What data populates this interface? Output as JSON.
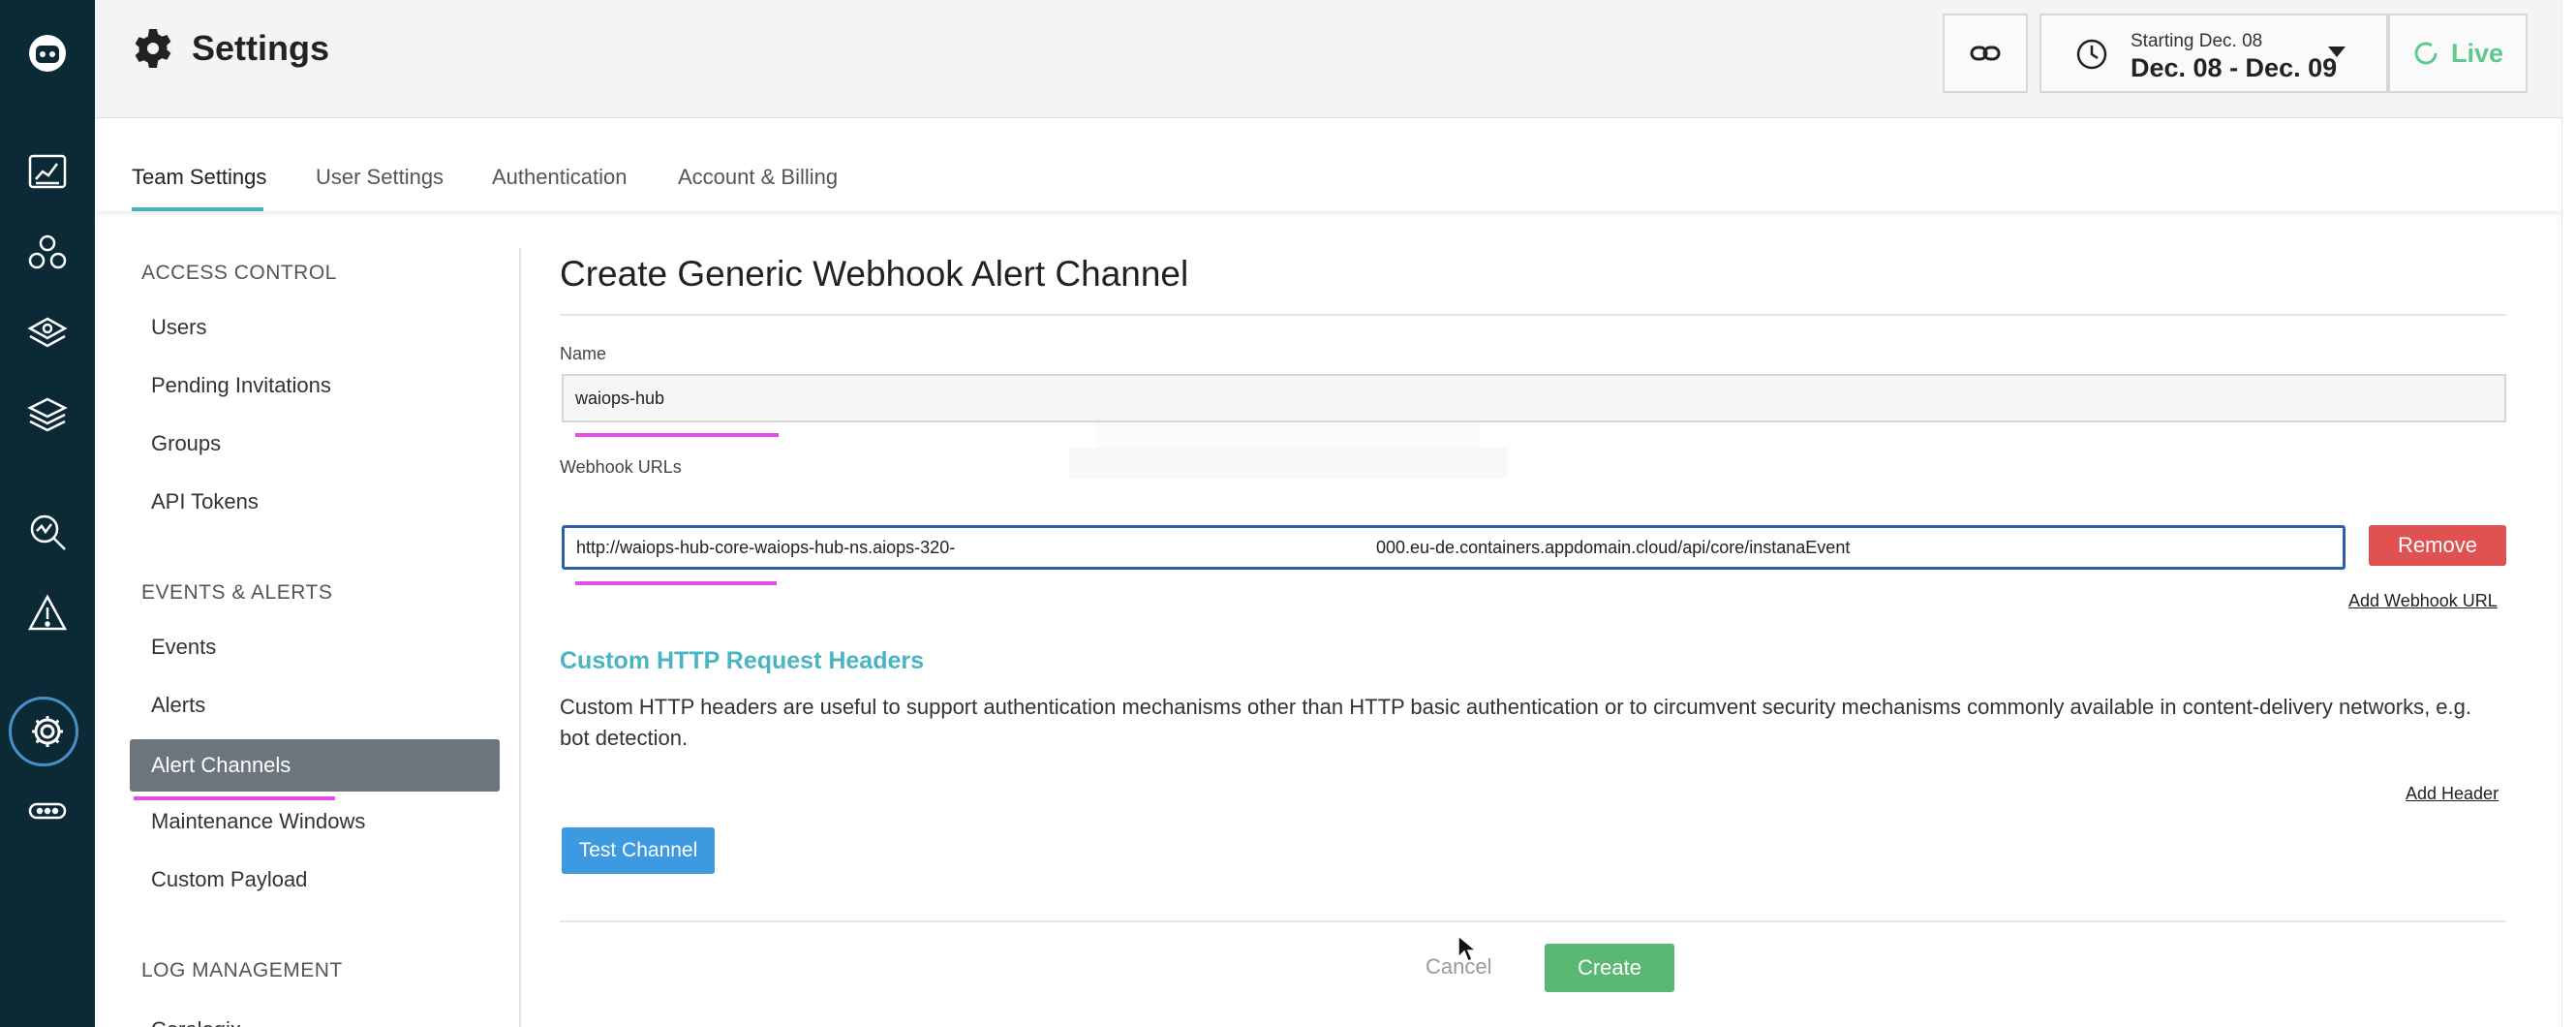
{
  "header": {
    "title": "Settings",
    "date_range_caption": "Starting Dec. 08",
    "date_range": "Dec. 08 - Dec. 09",
    "live_label": "Live"
  },
  "tabs": [
    {
      "label": "Team Settings",
      "active": true
    },
    {
      "label": "User Settings",
      "active": false
    },
    {
      "label": "Authentication",
      "active": false
    },
    {
      "label": "Account & Billing",
      "active": false
    }
  ],
  "subnav": {
    "sections": [
      {
        "heading": "ACCESS CONTROL",
        "items": [
          "Users",
          "Pending Invitations",
          "Groups",
          "API Tokens"
        ]
      },
      {
        "heading": "EVENTS & ALERTS",
        "items": [
          "Events",
          "Alerts",
          "Alert Channels",
          "Maintenance Windows",
          "Custom Payload"
        ]
      },
      {
        "heading": "LOG MANAGEMENT",
        "items": [
          "Coralogix"
        ]
      }
    ],
    "selected": "Alert Channels"
  },
  "form": {
    "title": "Create Generic Webhook Alert Channel",
    "name_label": "Name",
    "name_value": "waiops-hub",
    "webhook_label": "Webhook URLs",
    "webhook_url_part1": "http://waiops-hub-core-waiops-hub-ns.aiops-320-",
    "webhook_url_part2": "000.eu-de.containers.appdomain.cloud/api/core/instanaEvent",
    "remove_label": "Remove",
    "add_webhook_label": "Add Webhook URL",
    "custom_headers_title": "Custom HTTP Request Headers",
    "custom_headers_desc": "Custom HTTP headers are useful to support authentication mechanisms other than HTTP basic authentication or to circumvent security mechanisms commonly available in content-delivery networks, e.g. bot detection.",
    "add_header_label": "Add Header",
    "test_label": "Test Channel",
    "cancel_label": "Cancel",
    "create_label": "Create"
  },
  "colors": {
    "rail": "#0c2a36",
    "accent": "#49b5c3",
    "remove": "#e05252",
    "test": "#3d9ae0",
    "create": "#5bb872",
    "annotation": "#e64ce6"
  },
  "icons": [
    "robot-logo-icon",
    "dashboard-icon",
    "applications-icon",
    "platform-icon",
    "infrastructure-icon",
    "analyze-icon",
    "alert-icon",
    "settings-icon",
    "more-icon",
    "link-icon",
    "clock-icon",
    "refresh-icon"
  ]
}
